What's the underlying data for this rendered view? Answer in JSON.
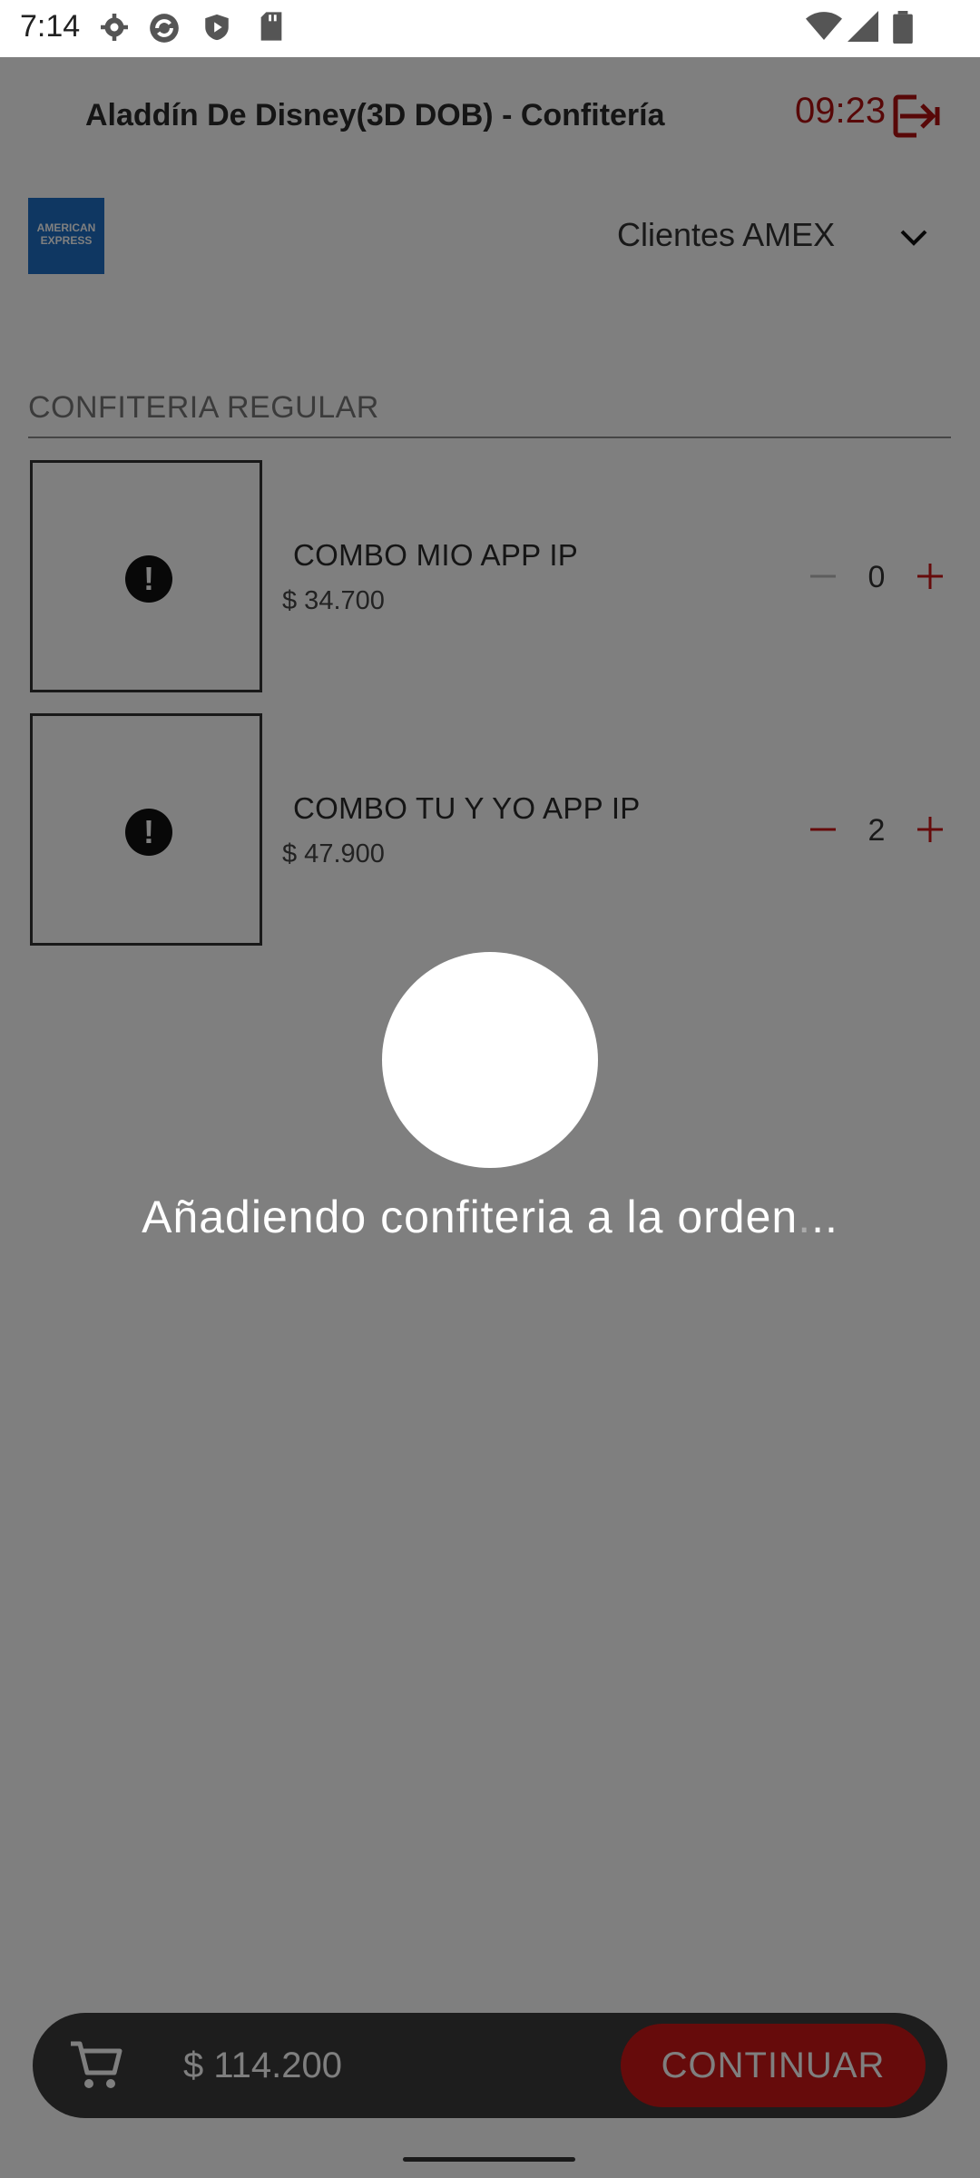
{
  "status_bar": {
    "time": "7:14",
    "icons": [
      "gear-icon",
      "sync-icon",
      "shield-play-icon",
      "sd-card-icon",
      "wifi-icon",
      "signal-icon",
      "battery-icon"
    ]
  },
  "header": {
    "title": "Aladdín De Disney(3D DOB) - Confitería",
    "timer": "09:23",
    "exit_icon": "exit-icon"
  },
  "client_selector": {
    "logo_text": "AMERICAN EXPRESS",
    "selected": "Clientes AMEX"
  },
  "section": {
    "title": "CONFITERIA REGULAR"
  },
  "items": [
    {
      "name": "COMBO MIO APP IP",
      "price": "$ 34.700",
      "quantity": "0"
    },
    {
      "name": "COMBO TU Y YO APP IP",
      "price": "$ 47.900",
      "quantity": "2"
    }
  ],
  "cart": {
    "total": "$ 114.200",
    "continue_label": "CONTINUAR"
  },
  "loader": {
    "message": "Añadiendo confiteria a la orden",
    "dots_dim": ".",
    "dots_bright": ".."
  },
  "colors": {
    "accent": "#cc1616",
    "amex_blue": "#1f6ec4",
    "overlay": "rgba(0,0,0,0.5)"
  }
}
